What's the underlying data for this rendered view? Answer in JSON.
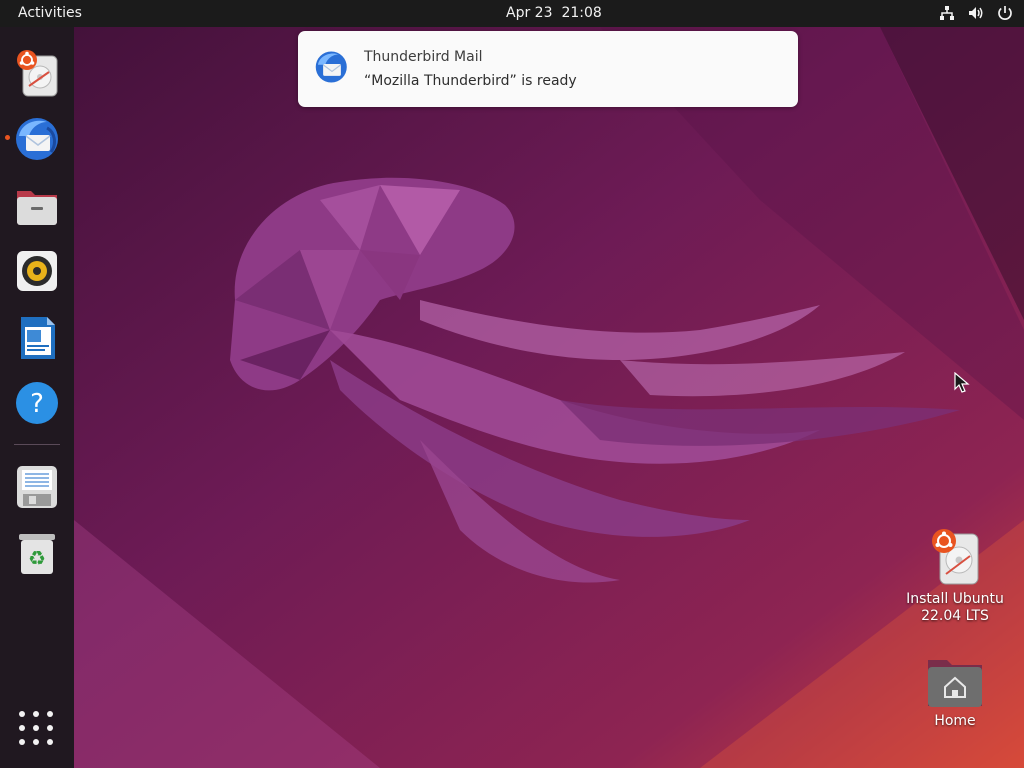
{
  "topbar": {
    "activities": "Activities",
    "date": "Apr 23",
    "time": "21:08",
    "tray_icons": [
      "network-icon",
      "volume-icon",
      "power-icon"
    ]
  },
  "dock": {
    "items": [
      {
        "name": "Install Ubuntu 22.04 LTS",
        "icon": "installer-icon"
      },
      {
        "name": "Thunderbird Mail",
        "icon": "thunderbird-icon",
        "running": true
      },
      {
        "name": "Files",
        "icon": "files-icon"
      },
      {
        "name": "Rhythmbox",
        "icon": "rhythmbox-icon"
      },
      {
        "name": "LibreOffice Writer",
        "icon": "writer-icon"
      },
      {
        "name": "Help",
        "icon": "help-icon"
      },
      {
        "name": "Floppy/Disk",
        "icon": "disk-icon"
      },
      {
        "name": "Trash",
        "icon": "trash-icon"
      }
    ],
    "show_apps_icon": "apps-grid-icon"
  },
  "notification": {
    "app": "Thunderbird Mail",
    "message": "“Mozilla Thunderbird” is ready",
    "icon": "thunderbird-icon"
  },
  "desktop": {
    "icons": [
      {
        "label_line1": "Install Ubuntu",
        "label_line2": "22.04 LTS",
        "icon": "installer-icon"
      },
      {
        "label_line1": "Home",
        "icon": "home-folder-icon"
      }
    ]
  },
  "colors": {
    "topbar": "#1b1b1b",
    "dock": "#201820",
    "accent": "#e95420",
    "wallpaper_dark": "#4a1340",
    "wallpaper_light": "#c0305a"
  }
}
